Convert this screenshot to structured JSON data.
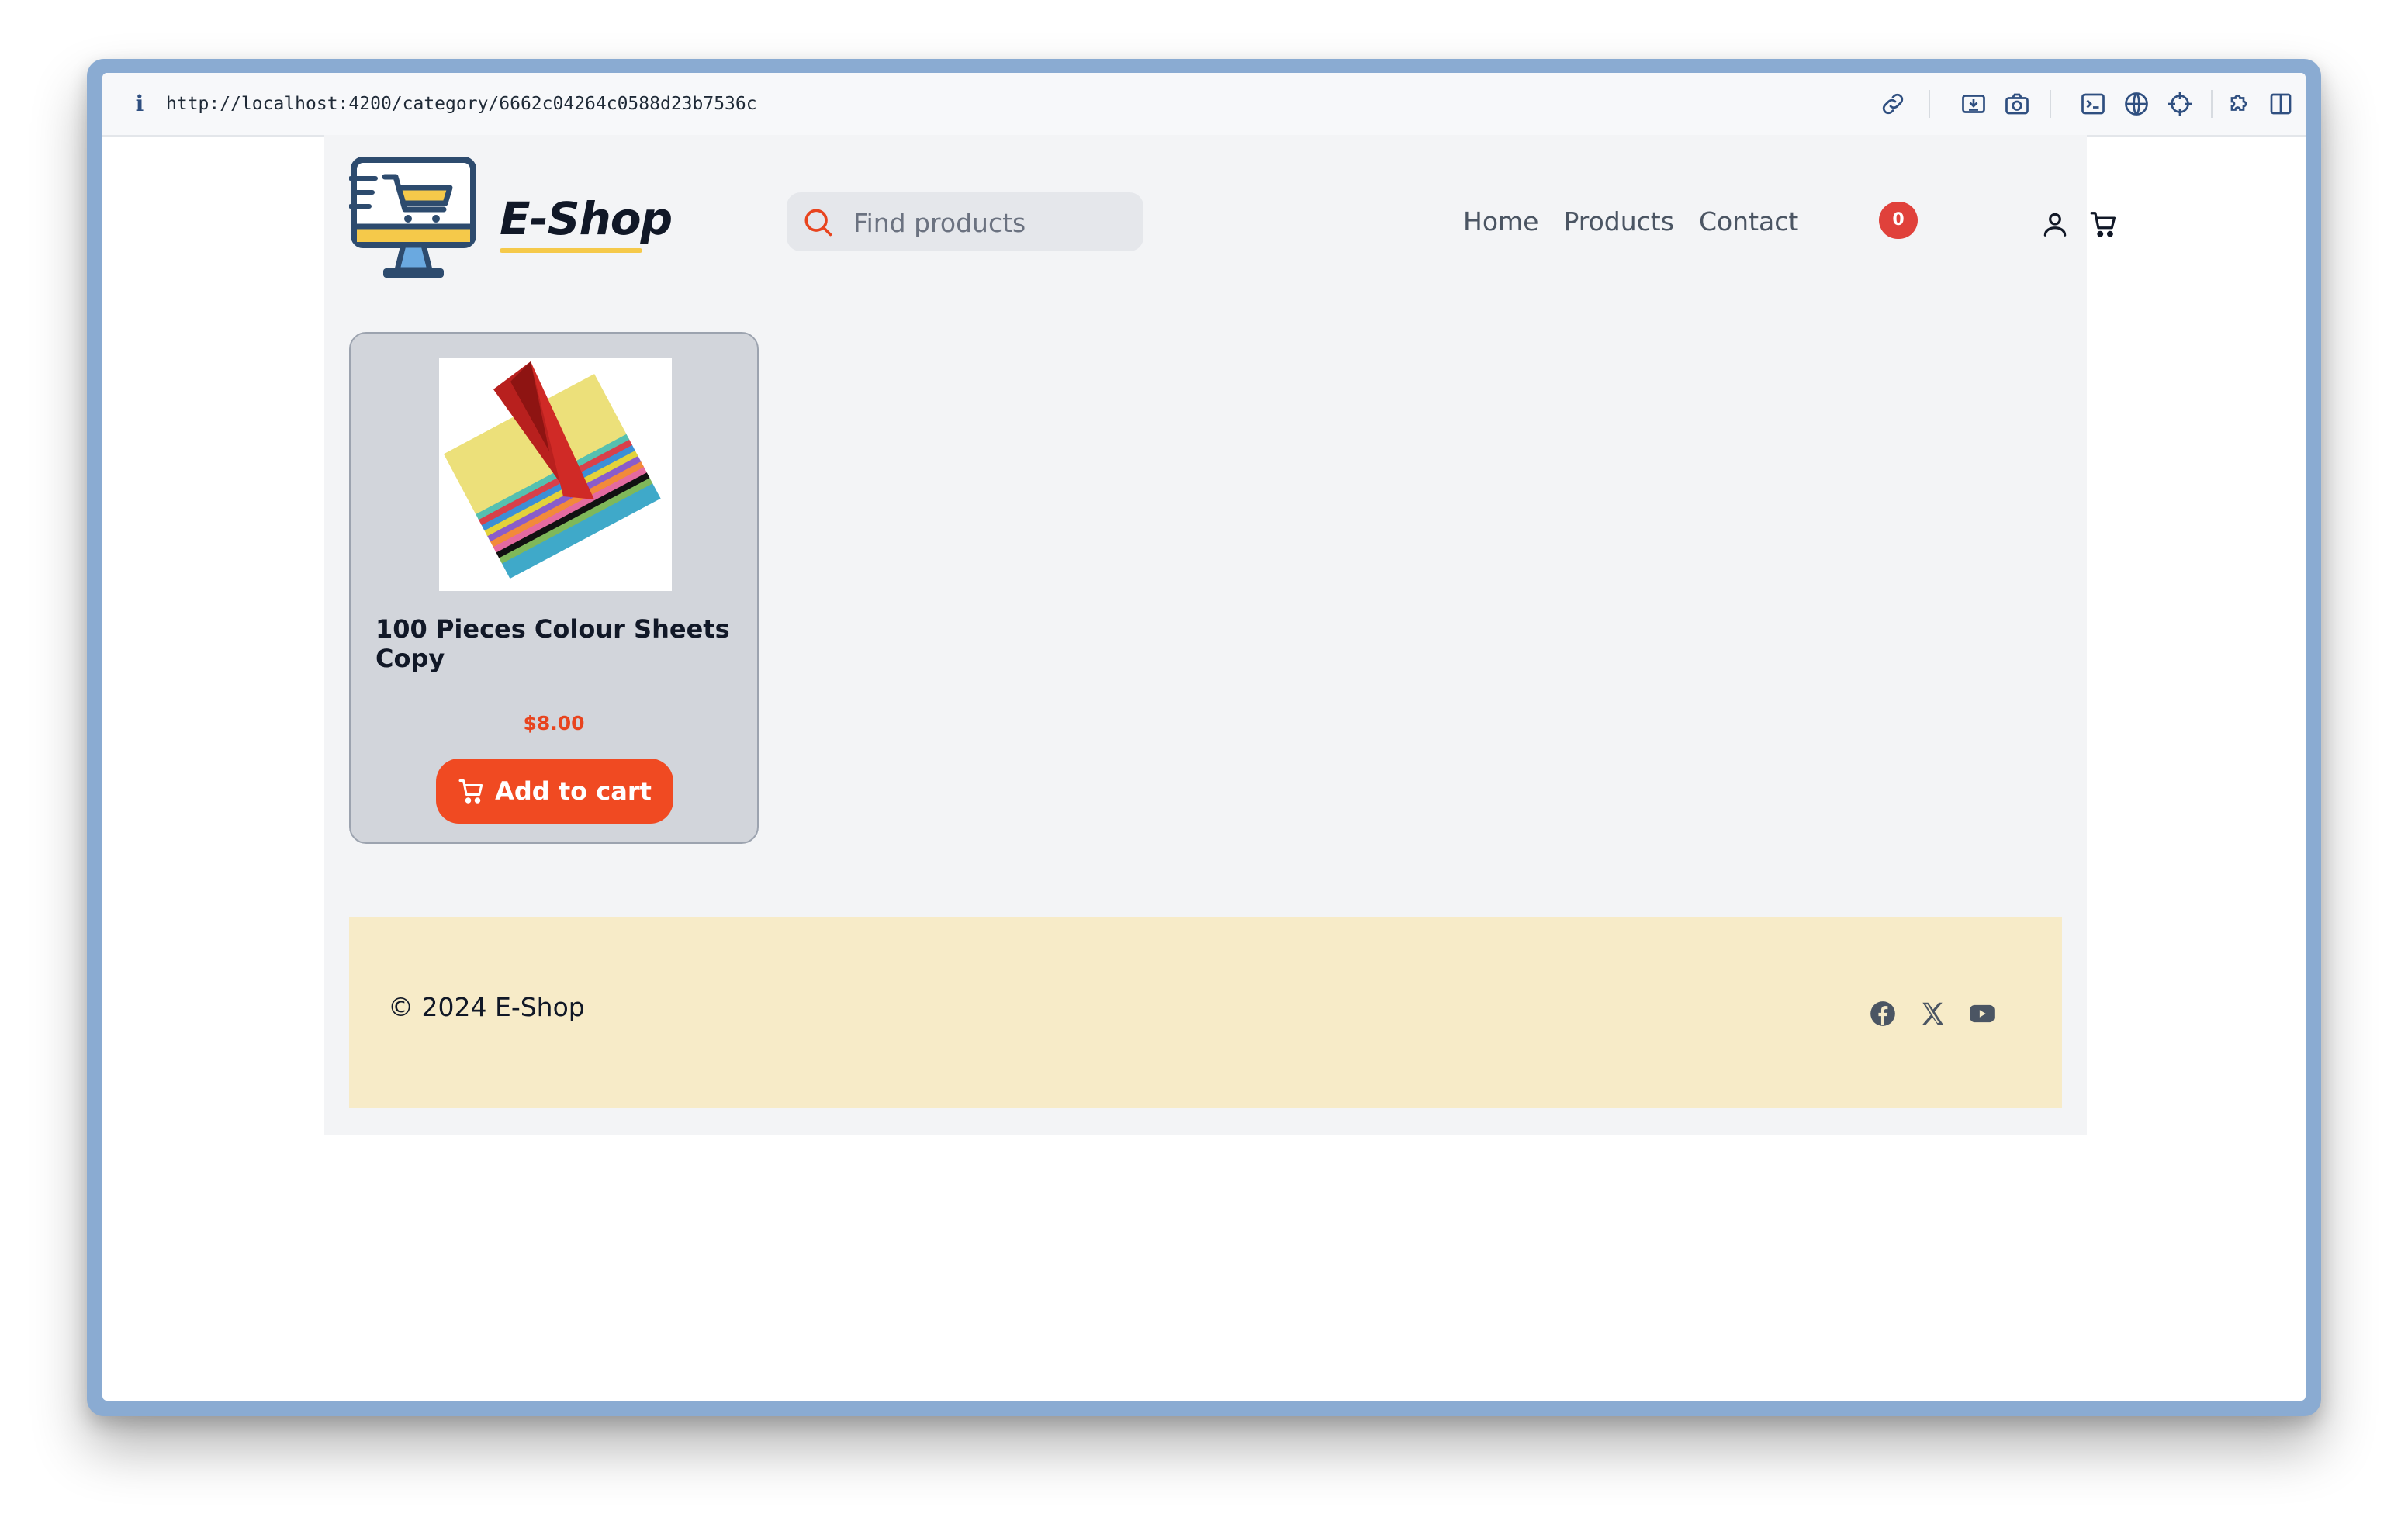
{
  "browser": {
    "url": "http://localhost:4200/category/6662c04264c0588d23b7536c",
    "info_icon": "i",
    "toolbar_icons": [
      "link-icon",
      "download-icon",
      "camera-icon",
      "terminal-icon",
      "globe-icon",
      "crosshair-icon",
      "extension-icon",
      "sidebar-icon"
    ]
  },
  "header": {
    "brand": "E-Shop",
    "search_placeholder": "Find products",
    "nav": [
      "Home",
      "Products",
      "Contact"
    ],
    "cart_count": "0"
  },
  "products": [
    {
      "title": "100 Pieces Colour Sheets Copy",
      "price": "$8.00",
      "button_label": "Add to cart"
    }
  ],
  "footer": {
    "copyright": "© 2024 E-Shop",
    "social_icons": [
      "facebook-icon",
      "x-icon",
      "youtube-icon"
    ]
  },
  "colors": {
    "accent": "#f04a22",
    "badge": "#e0413b",
    "footer_bg": "#f7ebc8",
    "window_frame": "#8aabd2"
  }
}
